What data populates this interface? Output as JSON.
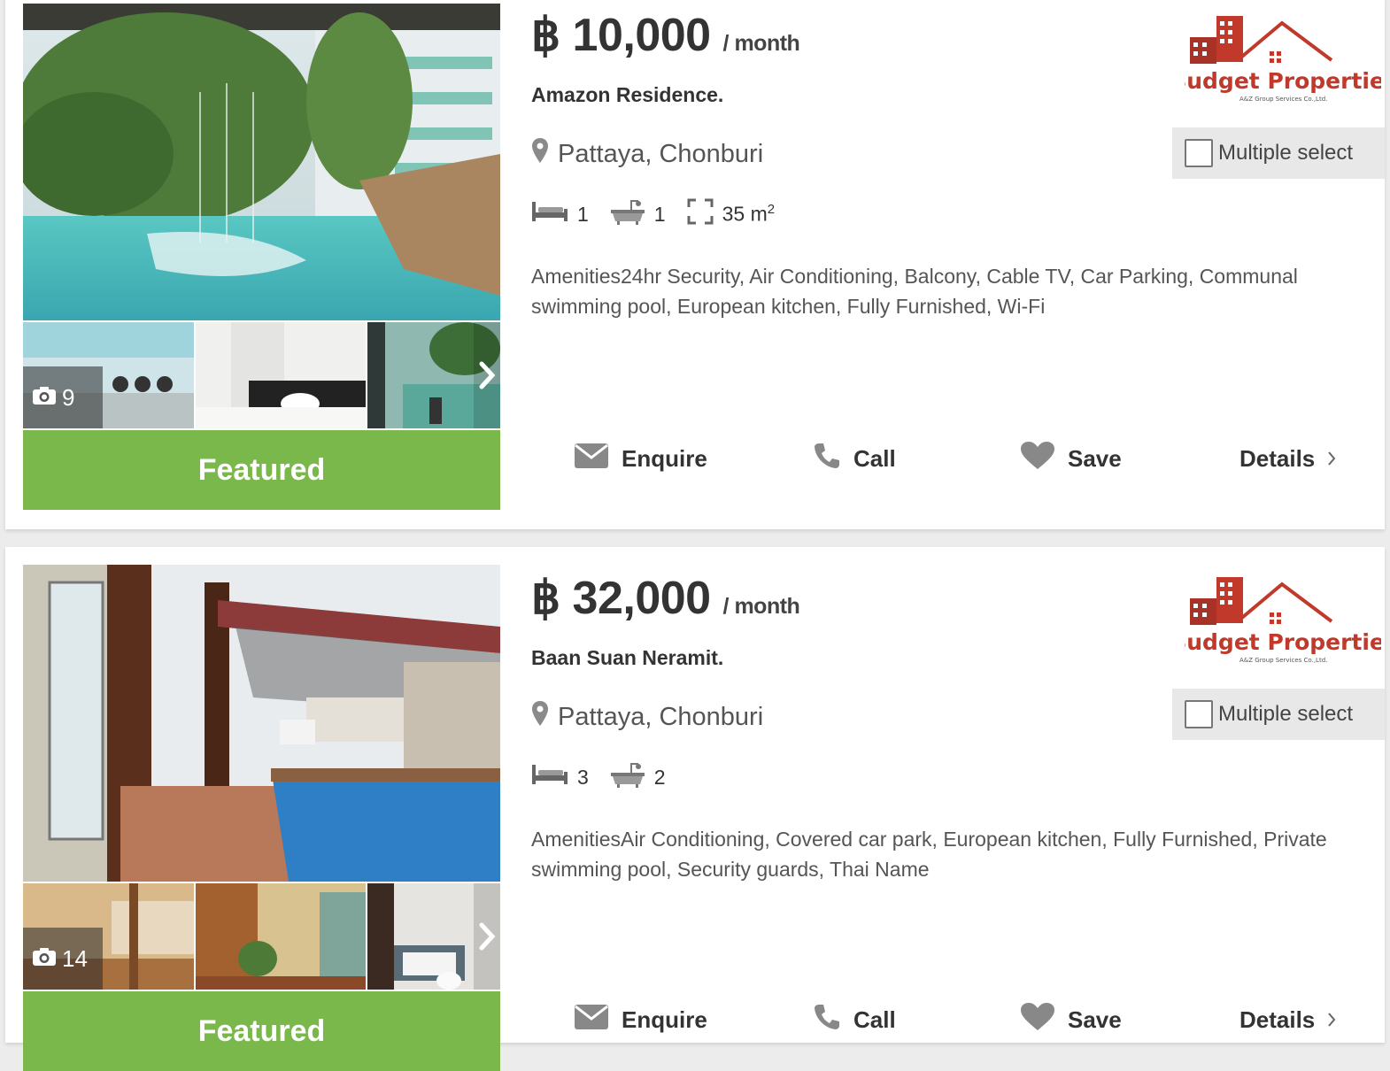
{
  "listings": [
    {
      "currency": "฿",
      "price": "10,000",
      "per": "/ month",
      "title": "Amazon Residence.",
      "location": "Pattaya, Chonburi",
      "beds": "1",
      "baths": "1",
      "area": "35 m",
      "area_sup": "2",
      "amenities": "Amenities24hr Security, Air Conditioning, Balcony, Cable TV, Car Parking, Communal swimming pool, European kitchen, Fully Furnished, Wi-Fi",
      "photo_count": "9",
      "featured": "Featured",
      "multi_select": "Multiple select",
      "actions": {
        "enquire": "Enquire",
        "call": "Call",
        "save": "Save",
        "details": "Details"
      },
      "logo_name": "Budget Properties",
      "logo_sub": "A&Z Group Services Co.,Ltd."
    },
    {
      "currency": "฿",
      "price": "32,000",
      "per": "/ month",
      "title": "Baan Suan Neramit.",
      "location": "Pattaya, Chonburi",
      "beds": "3",
      "baths": "2",
      "amenities": "AmenitiesAir Conditioning, Covered car park, European kitchen, Fully Furnished, Private swimming pool, Security guards, Thai Name",
      "photo_count": "14",
      "featured": "Featured",
      "multi_select": "Multiple select",
      "actions": {
        "enquire": "Enquire",
        "call": "Call",
        "save": "Save",
        "details": "Details"
      },
      "logo_name": "Budget Properties",
      "logo_sub": "A&Z Group Services Co.,Ltd."
    }
  ],
  "icons": [
    "camera-icon",
    "chevron-right-icon",
    "map-pin-icon",
    "bed-icon",
    "bath-icon",
    "area-icon",
    "envelope-icon",
    "phone-icon",
    "heart-icon"
  ],
  "colors": {
    "featured": "#7ab84c",
    "logo_red": "#c0392b"
  }
}
